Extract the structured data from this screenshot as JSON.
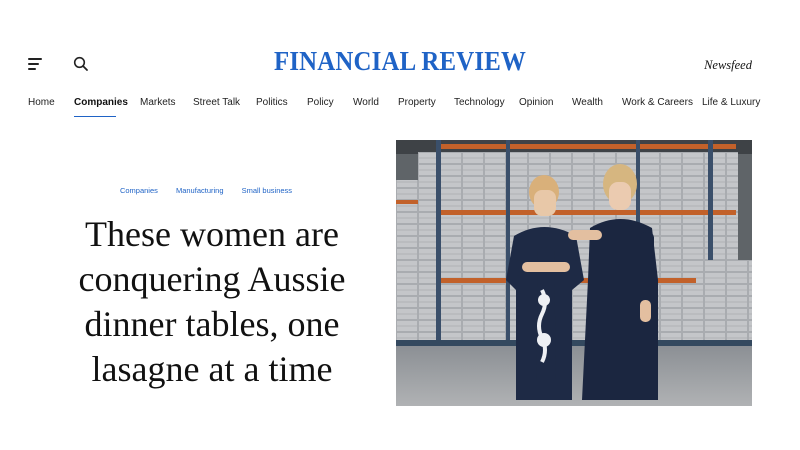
{
  "header": {
    "logo_text": "FINANCIAL REVIEW",
    "newsfeed_label": "Newsfeed",
    "brand_color": "#1f63c6",
    "menu_icon": "hamburger-menu-icon",
    "search_icon": "search-icon"
  },
  "nav": {
    "items": [
      "Home",
      "Companies",
      "Markets",
      "Street Talk",
      "Politics",
      "Policy",
      "World",
      "Property",
      "Technology",
      "Opinion",
      "Wealth",
      "Work & Careers",
      "Life & Luxury"
    ],
    "active": "Companies"
  },
  "article": {
    "tags": [
      "Companies",
      "Manufacturing",
      "Small business"
    ],
    "headline": "These women are conquering Aussie dinner tables, one lasagne at a time",
    "image": "photo-two-women-in-navy-dresses-in-warehouse"
  }
}
